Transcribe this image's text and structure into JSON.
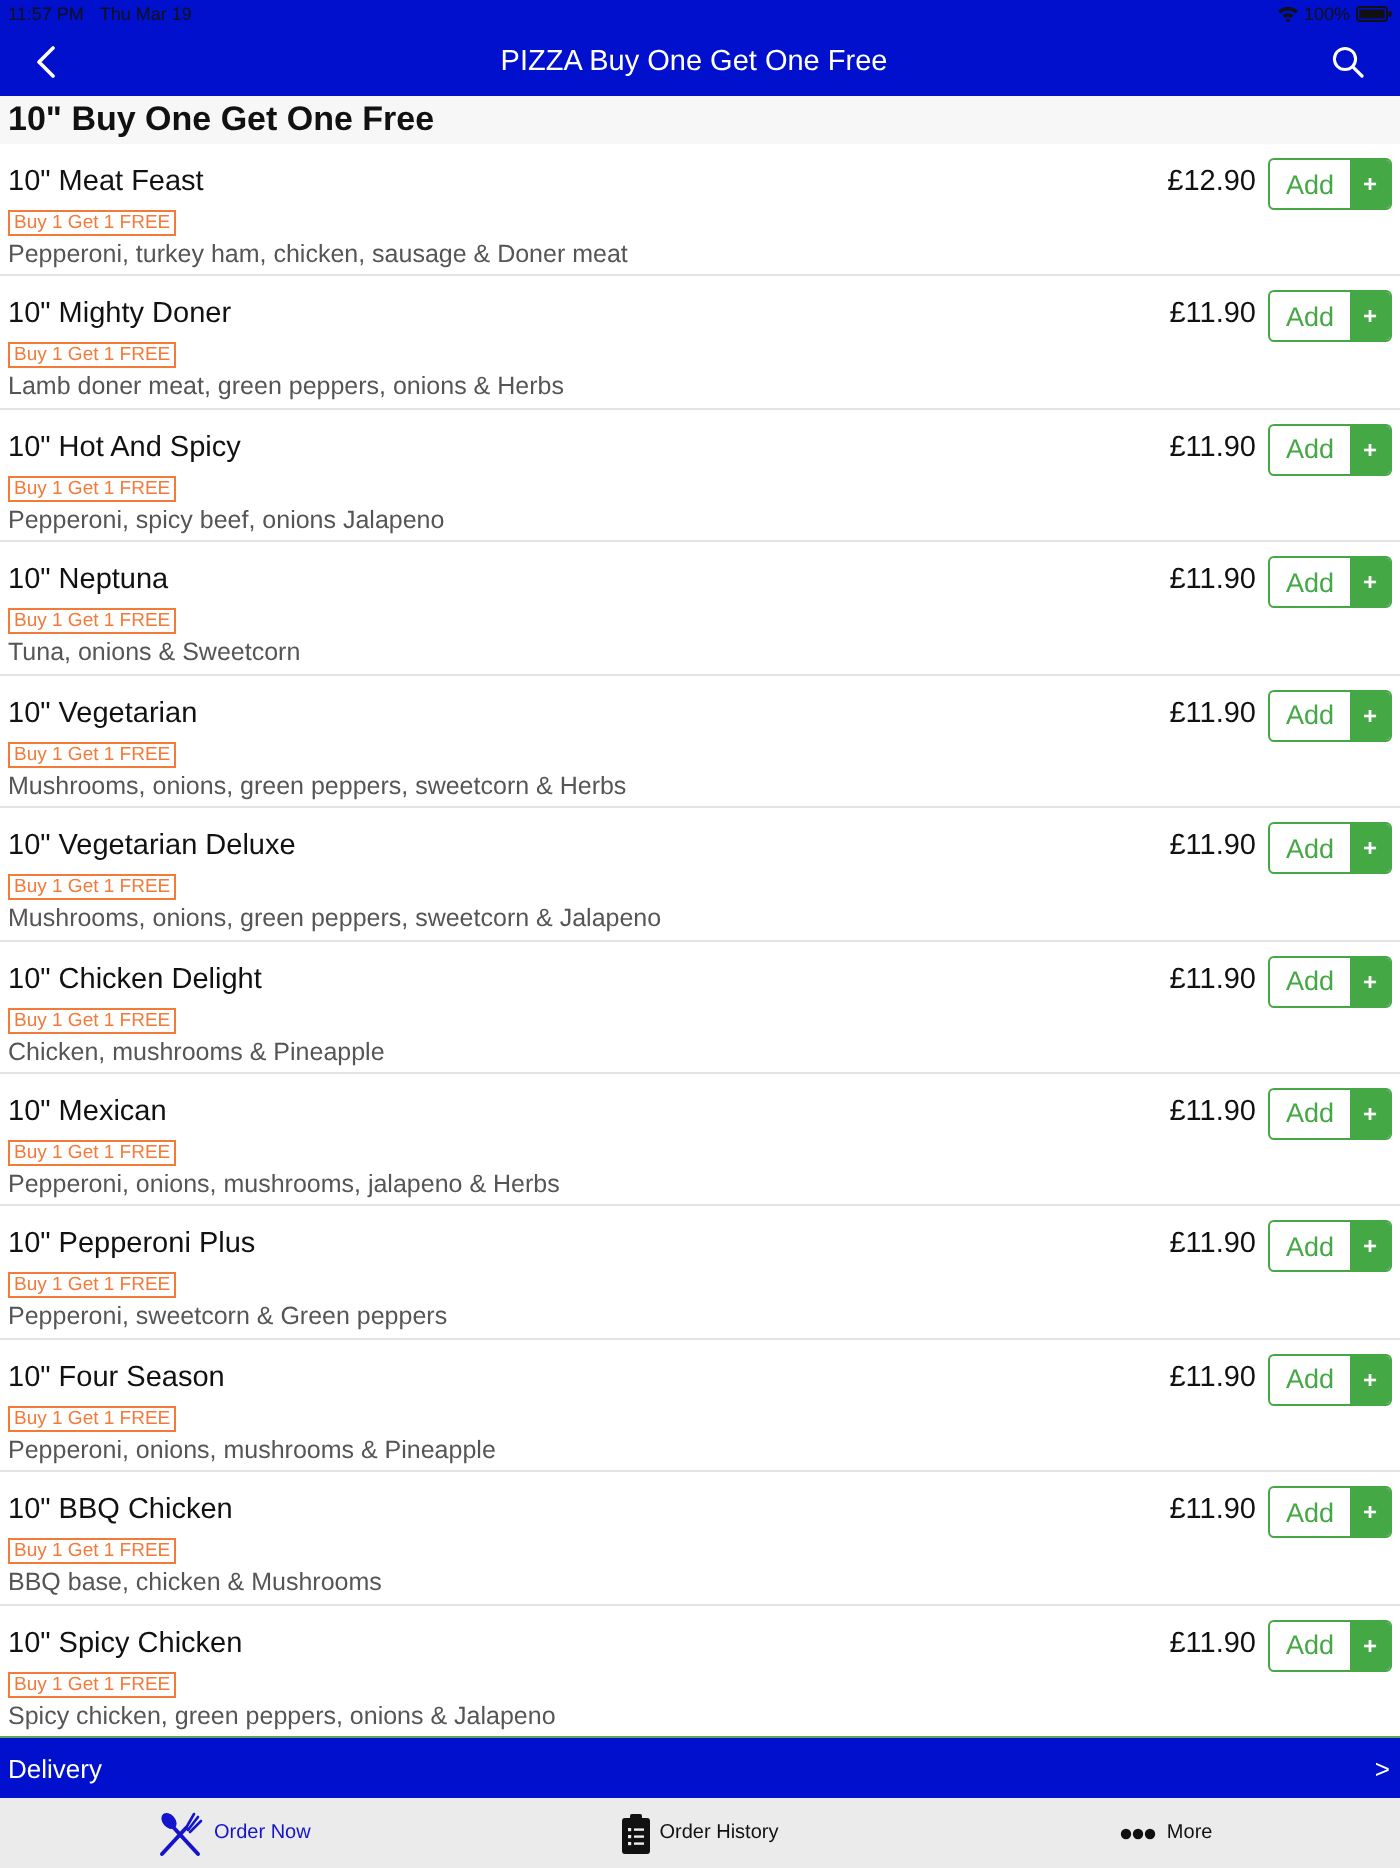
{
  "status_bar": {
    "time": "11:57 PM",
    "date": "Thu Mar 19",
    "battery": "100%"
  },
  "nav_bar": {
    "title": "PIZZA Buy One Get One Free"
  },
  "section": {
    "title": "10\" Buy One Get One Free"
  },
  "items": [
    {
      "name": "10\" Meat Feast",
      "badge": "Buy 1 Get 1 FREE",
      "description": "Pepperoni, turkey ham, chicken, sausage & Doner meat",
      "price": "£12.90",
      "add_label": "Add",
      "plus": "+"
    },
    {
      "name": "10\" Mighty Doner",
      "badge": "Buy 1 Get 1 FREE",
      "description": "Lamb doner meat, green peppers, onions & Herbs",
      "price": "£11.90",
      "add_label": "Add",
      "plus": "+"
    },
    {
      "name": "10\" Hot And Spicy",
      "badge": "Buy 1 Get 1 FREE",
      "description": "Pepperoni, spicy beef, onions Jalapeno",
      "price": "£11.90",
      "add_label": "Add",
      "plus": "+"
    },
    {
      "name": "10\" Neptuna",
      "badge": "Buy 1 Get 1 FREE",
      "description": "Tuna, onions & Sweetcorn",
      "price": "£11.90",
      "add_label": "Add",
      "plus": "+"
    },
    {
      "name": "10\" Vegetarian",
      "badge": "Buy 1 Get 1 FREE",
      "description": "Mushrooms, onions, green peppers, sweetcorn & Herbs",
      "price": "£11.90",
      "add_label": "Add",
      "plus": "+"
    },
    {
      "name": "10\" Vegetarian Deluxe",
      "badge": "Buy 1 Get 1 FREE",
      "description": "Mushrooms, onions, green peppers, sweetcorn & Jalapeno",
      "price": "£11.90",
      "add_label": "Add",
      "plus": "+"
    },
    {
      "name": "10\" Chicken Delight",
      "badge": "Buy 1 Get 1 FREE",
      "description": "Chicken, mushrooms & Pineapple",
      "price": "£11.90",
      "add_label": "Add",
      "plus": "+"
    },
    {
      "name": "10\" Mexican",
      "badge": "Buy 1 Get 1 FREE",
      "description": "Pepperoni, onions, mushrooms, jalapeno & Herbs",
      "price": "£11.90",
      "add_label": "Add",
      "plus": "+"
    },
    {
      "name": "10\" Pepperoni Plus",
      "badge": "Buy 1 Get 1 FREE",
      "description": "Pepperoni, sweetcorn & Green peppers",
      "price": "£11.90",
      "add_label": "Add",
      "plus": "+"
    },
    {
      "name": "10\" Four Season",
      "badge": "Buy 1 Get 1 FREE",
      "description": "Pepperoni, onions, mushrooms & Pineapple",
      "price": "£11.90",
      "add_label": "Add",
      "plus": "+"
    },
    {
      "name": "10\" BBQ Chicken",
      "badge": "Buy 1 Get 1 FREE",
      "description": "BBQ base, chicken & Mushrooms",
      "price": "£11.90",
      "add_label": "Add",
      "plus": "+"
    },
    {
      "name": "10\" Spicy Chicken",
      "badge": "Buy 1 Get 1 FREE",
      "description": "Spicy chicken, green peppers, onions & Jalapeno",
      "price": "£11.90",
      "add_label": "Add",
      "plus": "+"
    }
  ],
  "delivery_bar": {
    "label": "Delivery",
    "arrow": ">"
  },
  "tab_bar": [
    {
      "label": "Order Now",
      "selected": true
    },
    {
      "label": "Order History",
      "selected": false
    },
    {
      "label": "More",
      "selected": false
    }
  ]
}
